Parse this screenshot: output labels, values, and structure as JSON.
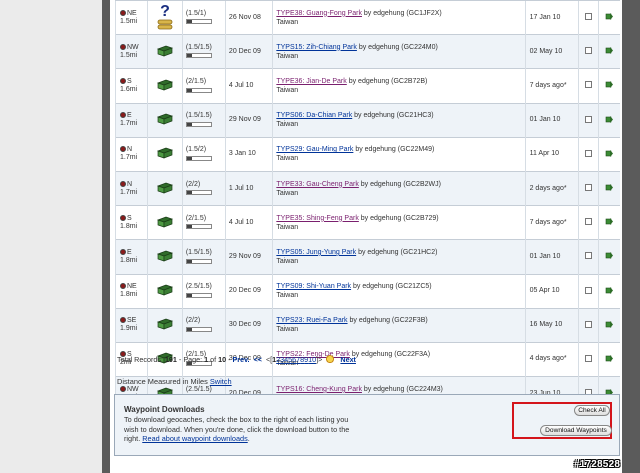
{
  "rows": [
    {
      "dir": "NE",
      "dist": "1.5mi",
      "type": "mystery",
      "diff": "(1.5/1)",
      "size_fill": 0.2,
      "placed": "26 Nov 08",
      "name": "TYPE38: Guang-Fong Park",
      "by": " by edgehung (GC1JF2X)",
      "country": "Taiwan",
      "found": "17 Jan 10",
      "visited": true
    },
    {
      "dir": "NW",
      "dist": "1.5mi",
      "type": "traditional",
      "diff": "(1.5/1.5)",
      "size_fill": 0.2,
      "placed": "20 Dec 09",
      "name": "TYPS15: Zih-Chiang Park",
      "by": " by edgehung (GC224M0)",
      "country": "Taiwan",
      "found": "02 May 10",
      "visited": false
    },
    {
      "dir": "S",
      "dist": "1.6mi",
      "type": "traditional",
      "diff": "(2/1.5)",
      "size_fill": 0.2,
      "placed": "4 Jul 10",
      "name": "TYPE36: Jian-De Park",
      "by": " by edgehung (GC2B72B)",
      "country": "Taiwan",
      "found": "7 days ago*",
      "visited": true
    },
    {
      "dir": "E",
      "dist": "1.7mi",
      "type": "traditional",
      "diff": "(1.5/1.5)",
      "size_fill": 0.2,
      "placed": "29 Nov 09",
      "name": "TYPS06: Da-Chian Park",
      "by": " by edgehung (GC21HC3)",
      "country": "Taiwan",
      "found": "01 Jan 10",
      "visited": false
    },
    {
      "dir": "N",
      "dist": "1.7mi",
      "type": "traditional",
      "diff": "(1.5/2)",
      "size_fill": 0.2,
      "placed": "3 Jan 10",
      "name": "TYPS29: Gau-Ming Park",
      "by": " by edgehung (GC22M49)",
      "country": "Taiwan",
      "found": "11 Apr 10",
      "visited": false
    },
    {
      "dir": "N",
      "dist": "1.7mi",
      "type": "traditional",
      "diff": "(2/2)",
      "size_fill": 0.2,
      "placed": "1 Jul 10",
      "name": "TYPE33: Gau-Cheng Park",
      "by": " by edgehung (GC2B2WJ)",
      "country": "Taiwan",
      "found": "2 days ago*",
      "visited": true
    },
    {
      "dir": "S",
      "dist": "1.8mi",
      "type": "traditional",
      "diff": "(2/1.5)",
      "size_fill": 0.2,
      "placed": "4 Jul 10",
      "name": "TYPE35: Shing-Feng Park",
      "by": " by edgehung (GC2B729)",
      "country": "Taiwan",
      "found": "7 days ago*",
      "visited": true
    },
    {
      "dir": "E",
      "dist": "1.8mi",
      "type": "traditional",
      "diff": "(1.5/1.5)",
      "size_fill": 0.2,
      "placed": "29 Nov 09",
      "name": "TYPS05: Jung-Yung Park",
      "by": " by edgehung (GC21HC2)",
      "country": "Taiwan",
      "found": "01 Jan 10",
      "visited": false
    },
    {
      "dir": "NE",
      "dist": "1.8mi",
      "type": "traditional",
      "diff": "(2.5/1.5)",
      "size_fill": 0.2,
      "placed": "20 Dec 09",
      "name": "TYPS09: Shi-Yuan Park",
      "by": " by edgehung (GC21ZC5)",
      "country": "Taiwan",
      "found": "05 Apr 10",
      "visited": false
    },
    {
      "dir": "SE",
      "dist": "1.9mi",
      "type": "traditional",
      "diff": "(2/2)",
      "size_fill": 0.2,
      "placed": "30 Dec 09",
      "name": "TYPS23: Ruei-Fa Park",
      "by": " by edgehung (GC22F3B)",
      "country": "Taiwan",
      "found": "16 May 10",
      "visited": false
    },
    {
      "dir": "S",
      "dist": "2mi",
      "type": "traditional",
      "diff": "(2/1.5)",
      "size_fill": 0.2,
      "placed": "30 Dec 09",
      "name": "TYPS22: Feng-De Park",
      "by": " by edgehung (GC22F3A)",
      "country": "Taiwan",
      "found": "4 days ago*",
      "visited": true
    },
    {
      "dir": "NW",
      "dist": "2.1mi",
      "type": "traditional",
      "diff": "(2.5/1.5)",
      "size_fill": 0.2,
      "placed": "20 Dec 09",
      "name": "TYPS16: Cheng-Kung Park",
      "by": " by edgehung (GC224M3)",
      "country": "Taiwan",
      "found": "23 Jun 10",
      "visited": true
    }
  ],
  "pager": {
    "total_label": "Total Records: ",
    "total": "191",
    "page_label": " - Page: ",
    "page": "1",
    "of_label": " of ",
    "pages": "10",
    "dash": " - ",
    "prev": "Prev.",
    "prev_arrows": "<<",
    "open_bracket": "<[",
    "page_links": [
      "1",
      "2",
      "3",
      "4",
      "5",
      "6",
      "7",
      "8",
      "9",
      "10"
    ],
    "close_bracket": "]>",
    "next": "Next"
  },
  "distance": {
    "text": "Distance Measured in Miles ",
    "switch": "Switch"
  },
  "waypoints": {
    "title": "Waypoint Downloads",
    "desc": "To download geocaches, check the box to the right of each listing you wish to download. When you're done, click the download button to the right. ",
    "link": "Read about waypoint downloads",
    "link_end": ".",
    "check_all": "Check All",
    "download": "Download Waypoints"
  },
  "watermark": "#1728528",
  "colors": {
    "link": "#003399",
    "visited_link": "#7a1f6e",
    "highlight": "#d4141b",
    "row_alt": "#eef3f8"
  }
}
